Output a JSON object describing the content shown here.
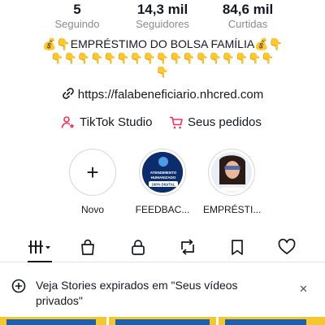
{
  "stats": [
    {
      "value": "5",
      "label": "Seguindo"
    },
    {
      "value": "14,3 mil",
      "label": "Seguidores"
    },
    {
      "value": "84,6 mil",
      "label": "Curtidas"
    }
  ],
  "bio": {
    "line1": "💰👇EMPRÉSTIMO DO BOLSA FAMÍLIA💰👇",
    "line2": "👇👇👇👇👇👇👇👇👇👇👇👇👇👇👇👇👇",
    "line3": "👇"
  },
  "link": {
    "url": "https://falabeneficiario.nhcred.com"
  },
  "quick_actions": {
    "studio": "TikTok Studio",
    "orders": "Seus pedidos"
  },
  "stories": [
    {
      "label": "Novo"
    },
    {
      "label": "FEEDBAC...",
      "thumb_text": [
        "ATENDIMENTO",
        "HUMANIZADO",
        "100% DIGITAL"
      ]
    },
    {
      "label": "EMPRÉSTI..."
    }
  ],
  "tabs": [
    "grid-icon",
    "bag-icon",
    "lock-icon",
    "repost-icon",
    "bookmark-icon",
    "heart-icon"
  ],
  "banner": {
    "text": "Veja Stories expirados em \"Seus vídeos privados\"",
    "close": "✕"
  },
  "colors": {
    "accent_red": "#fe2c55",
    "muted": "#8a8b91",
    "thumb_yellow": "#f4c72d",
    "thumb_blue": "#1b5fb5"
  }
}
